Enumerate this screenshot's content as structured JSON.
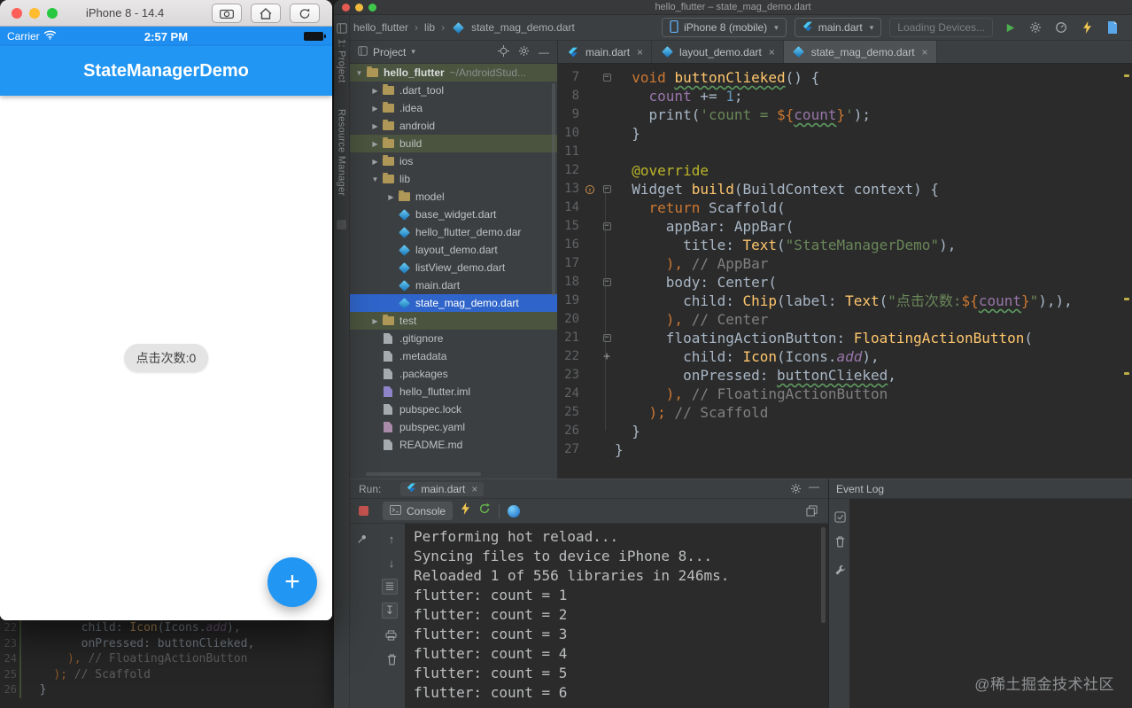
{
  "colors": {
    "accent_blue": "#2196f3",
    "selection_blue": "#2f65ca",
    "ide_panel_bg": "#3c3f41",
    "editor_bg": "#2b2b2b",
    "keyword_orange": "#cc7832",
    "string_green": "#6a8759",
    "field_purple": "#9876aa",
    "function_yellow": "#ffc66d",
    "comment_gray": "#808080",
    "number_blue": "#6897bb"
  },
  "simulator": {
    "window_title": "iPhone 8 - 14.4",
    "status_bar": {
      "carrier": "Carrier",
      "time": "2:57 PM"
    },
    "app_bar_title": "StateManagerDemo",
    "chip_label": "点击次数:0",
    "fab_label": "+"
  },
  "ide": {
    "window_title": "hello_flutter – state_mag_demo.dart",
    "breadcrumbs": [
      "hello_flutter",
      "lib",
      "state_mag_demo.dart"
    ],
    "toolbar": {
      "device_selector": "iPhone 8 (mobile)",
      "run_config": "main.dart",
      "devices_status": "Loading Devices..."
    },
    "tool_strip": {
      "items": [
        "1: Project",
        "Resource Manager"
      ]
    },
    "project_panel": {
      "title": "Project",
      "tree": [
        {
          "label": "hello_flutter",
          "suffix": " ~/AndroidStud...",
          "type": "folder",
          "indent": 0,
          "arrow": "down",
          "tint": true,
          "bold": true
        },
        {
          "label": ".dart_tool",
          "type": "folder",
          "indent": 1,
          "arrow": "right"
        },
        {
          "label": ".idea",
          "type": "folder",
          "indent": 1,
          "arrow": "right"
        },
        {
          "label": "android",
          "type": "folder",
          "indent": 1,
          "arrow": "right"
        },
        {
          "label": "build",
          "type": "folder",
          "indent": 1,
          "arrow": "right",
          "tint": true
        },
        {
          "label": "ios",
          "type": "folder",
          "indent": 1,
          "arrow": "right"
        },
        {
          "label": "lib",
          "type": "folder",
          "indent": 1,
          "arrow": "down"
        },
        {
          "label": "model",
          "type": "folder",
          "indent": 2,
          "arrow": "right"
        },
        {
          "label": "base_widget.dart",
          "type": "dart",
          "indent": 2
        },
        {
          "label": "hello_flutter_demo.dar",
          "type": "dart",
          "indent": 2
        },
        {
          "label": "layout_demo.dart",
          "type": "dart",
          "indent": 2
        },
        {
          "label": "listView_demo.dart",
          "type": "dart",
          "indent": 2
        },
        {
          "label": "main.dart",
          "type": "dart",
          "indent": 2
        },
        {
          "label": "state_mag_demo.dart",
          "type": "dart",
          "indent": 2,
          "selected": true
        },
        {
          "label": "test",
          "type": "folder",
          "indent": 1,
          "arrow": "right",
          "tint": true
        },
        {
          "label": ".gitignore",
          "type": "file",
          "indent": 1
        },
        {
          "label": ".metadata",
          "type": "file",
          "indent": 1
        },
        {
          "label": ".packages",
          "type": "file",
          "indent": 1
        },
        {
          "label": "hello_flutter.iml",
          "type": "iml",
          "indent": 1
        },
        {
          "label": "pubspec.lock",
          "type": "file",
          "indent": 1
        },
        {
          "label": "pubspec.yaml",
          "type": "yaml",
          "indent": 1
        },
        {
          "label": "README.md",
          "type": "file",
          "indent": 1
        }
      ]
    },
    "editor": {
      "tabs": [
        {
          "label": "main.dart",
          "active": false,
          "icon": "flutter"
        },
        {
          "label": "layout_demo.dart",
          "active": false,
          "icon": "dart"
        },
        {
          "label": "state_mag_demo.dart",
          "active": true,
          "icon": "dart"
        }
      ],
      "lines": [
        {
          "n": 7,
          "ind": 2,
          "fold": true,
          "tok": [
            [
              "void ",
              "kw"
            ],
            [
              "buttonClieked",
              "fn u"
            ],
            [
              "() {",
              "def"
            ]
          ]
        },
        {
          "n": 8,
          "ind": 4,
          "tok": [
            [
              "count",
              "fld"
            ],
            [
              " += ",
              "def"
            ],
            [
              "1",
              "num"
            ],
            [
              ";",
              "def"
            ]
          ]
        },
        {
          "n": 9,
          "ind": 4,
          "tok": [
            [
              "print(",
              "def"
            ],
            [
              "'count = ",
              "str"
            ],
            [
              "${",
              "kw"
            ],
            [
              "count",
              "fld u"
            ],
            [
              "}",
              "kw"
            ],
            [
              "'",
              "str"
            ],
            [
              ");",
              "def"
            ]
          ]
        },
        {
          "n": 10,
          "ind": 2,
          "tok": [
            [
              "}",
              "def"
            ]
          ]
        },
        {
          "n": 11,
          "ind": 0,
          "tok": []
        },
        {
          "n": 12,
          "ind": 2,
          "tok": [
            [
              "@override",
              "ann"
            ]
          ]
        },
        {
          "n": 13,
          "ind": 2,
          "fold": true,
          "marker": "override",
          "tok": [
            [
              "Widget ",
              "def"
            ],
            [
              "build",
              "fn"
            ],
            [
              "(BuildContext context) {",
              "def"
            ]
          ]
        },
        {
          "n": 14,
          "ind": 4,
          "tok": [
            [
              "return ",
              "kw"
            ],
            [
              "Scaffold(",
              "def"
            ]
          ]
        },
        {
          "n": 15,
          "ind": 6,
          "fold": true,
          "tok": [
            [
              "appBar: AppBar(",
              "def"
            ]
          ]
        },
        {
          "n": 16,
          "ind": 8,
          "tok": [
            [
              "title: ",
              "def"
            ],
            [
              "Text",
              "fn"
            ],
            [
              "(",
              "def"
            ],
            [
              "\"StateManagerDemo\"",
              "str"
            ],
            [
              "),",
              "def"
            ]
          ]
        },
        {
          "n": 17,
          "ind": 6,
          "tok": [
            [
              "), ",
              "kw"
            ],
            [
              "// AppBar",
              "cmt"
            ]
          ]
        },
        {
          "n": 18,
          "ind": 6,
          "fold": true,
          "tok": [
            [
              "body: Center(",
              "def"
            ]
          ]
        },
        {
          "n": 19,
          "ind": 8,
          "tok": [
            [
              "child: ",
              "def"
            ],
            [
              "Chip",
              "fn"
            ],
            [
              "(label: ",
              "def"
            ],
            [
              "Text",
              "fn"
            ],
            [
              "(",
              "def"
            ],
            [
              "\"点击次数:",
              "str"
            ],
            [
              "${",
              "kw"
            ],
            [
              "count",
              "fld u"
            ],
            [
              "}",
              "kw"
            ],
            [
              "\"",
              "str"
            ],
            [
              "),),",
              "def"
            ]
          ]
        },
        {
          "n": 20,
          "ind": 6,
          "tok": [
            [
              "), ",
              "kw"
            ],
            [
              "// Center",
              "cmt"
            ]
          ]
        },
        {
          "n": 21,
          "ind": 6,
          "fold": true,
          "tok": [
            [
              "floatingActionButton: ",
              "def"
            ],
            [
              "FloatingActionButton",
              "fn"
            ],
            [
              "(",
              "def"
            ]
          ]
        },
        {
          "n": 22,
          "ind": 8,
          "marker": "plus",
          "tok": [
            [
              "child: ",
              "def"
            ],
            [
              "Icon",
              "fn"
            ],
            [
              "(Icons.",
              "def"
            ],
            [
              "add",
              "fld i"
            ],
            [
              "),",
              "def"
            ]
          ]
        },
        {
          "n": 23,
          "ind": 8,
          "tok": [
            [
              "onPressed: ",
              "def"
            ],
            [
              "buttonClieked",
              "def u"
            ],
            [
              ",",
              "def"
            ]
          ]
        },
        {
          "n": 24,
          "ind": 6,
          "tok": [
            [
              "), ",
              "kw"
            ],
            [
              "// FloatingActionButton",
              "cmt"
            ]
          ]
        },
        {
          "n": 25,
          "ind": 4,
          "tok": [
            [
              "); ",
              "kw"
            ],
            [
              "// Scaffold",
              "cmt"
            ]
          ]
        },
        {
          "n": 26,
          "ind": 2,
          "tok": [
            [
              "}",
              "def"
            ]
          ]
        },
        {
          "n": 27,
          "ind": 0,
          "tok": [
            [
              "}",
              "def"
            ]
          ]
        }
      ]
    },
    "run_panel": {
      "label": "Run:",
      "tab": {
        "label": "main.dart"
      },
      "console_tab": "Console",
      "console_lines": [
        "Performing hot reload...",
        "Syncing files to device iPhone 8...",
        "Reloaded 1 of 556 libraries in 246ms.",
        "flutter: count = 1",
        "flutter: count = 2",
        "flutter: count = 3",
        "flutter: count = 4",
        "flutter: count = 5",
        "flutter: count = 6"
      ]
    },
    "event_log": {
      "title": "Event Log"
    },
    "watermark": "@稀土掘金技术社区",
    "background_editor": {
      "lines": [
        {
          "n": 22,
          "ind": 8,
          "tok": [
            [
              "child: ",
              "def"
            ],
            [
              "Icon",
              "fn"
            ],
            [
              "(Icons.",
              "def"
            ],
            [
              "add",
              "fld i"
            ],
            [
              "),",
              "def"
            ]
          ]
        },
        {
          "n": 23,
          "ind": 8,
          "tok": [
            [
              "onPressed: ",
              "def"
            ],
            [
              "buttonClieked",
              "def"
            ],
            [
              ",",
              "def"
            ]
          ]
        },
        {
          "n": 24,
          "ind": 6,
          "tok": [
            [
              "), ",
              "kw"
            ],
            [
              "// FloatingActionButton",
              "cmt"
            ]
          ]
        },
        {
          "n": 25,
          "ind": 4,
          "tok": [
            [
              "); ",
              "kw"
            ],
            [
              "// Scaffold",
              "cmt"
            ]
          ]
        },
        {
          "n": 26,
          "ind": 2,
          "tok": [
            [
              "}",
              "def"
            ]
          ]
        }
      ]
    }
  }
}
